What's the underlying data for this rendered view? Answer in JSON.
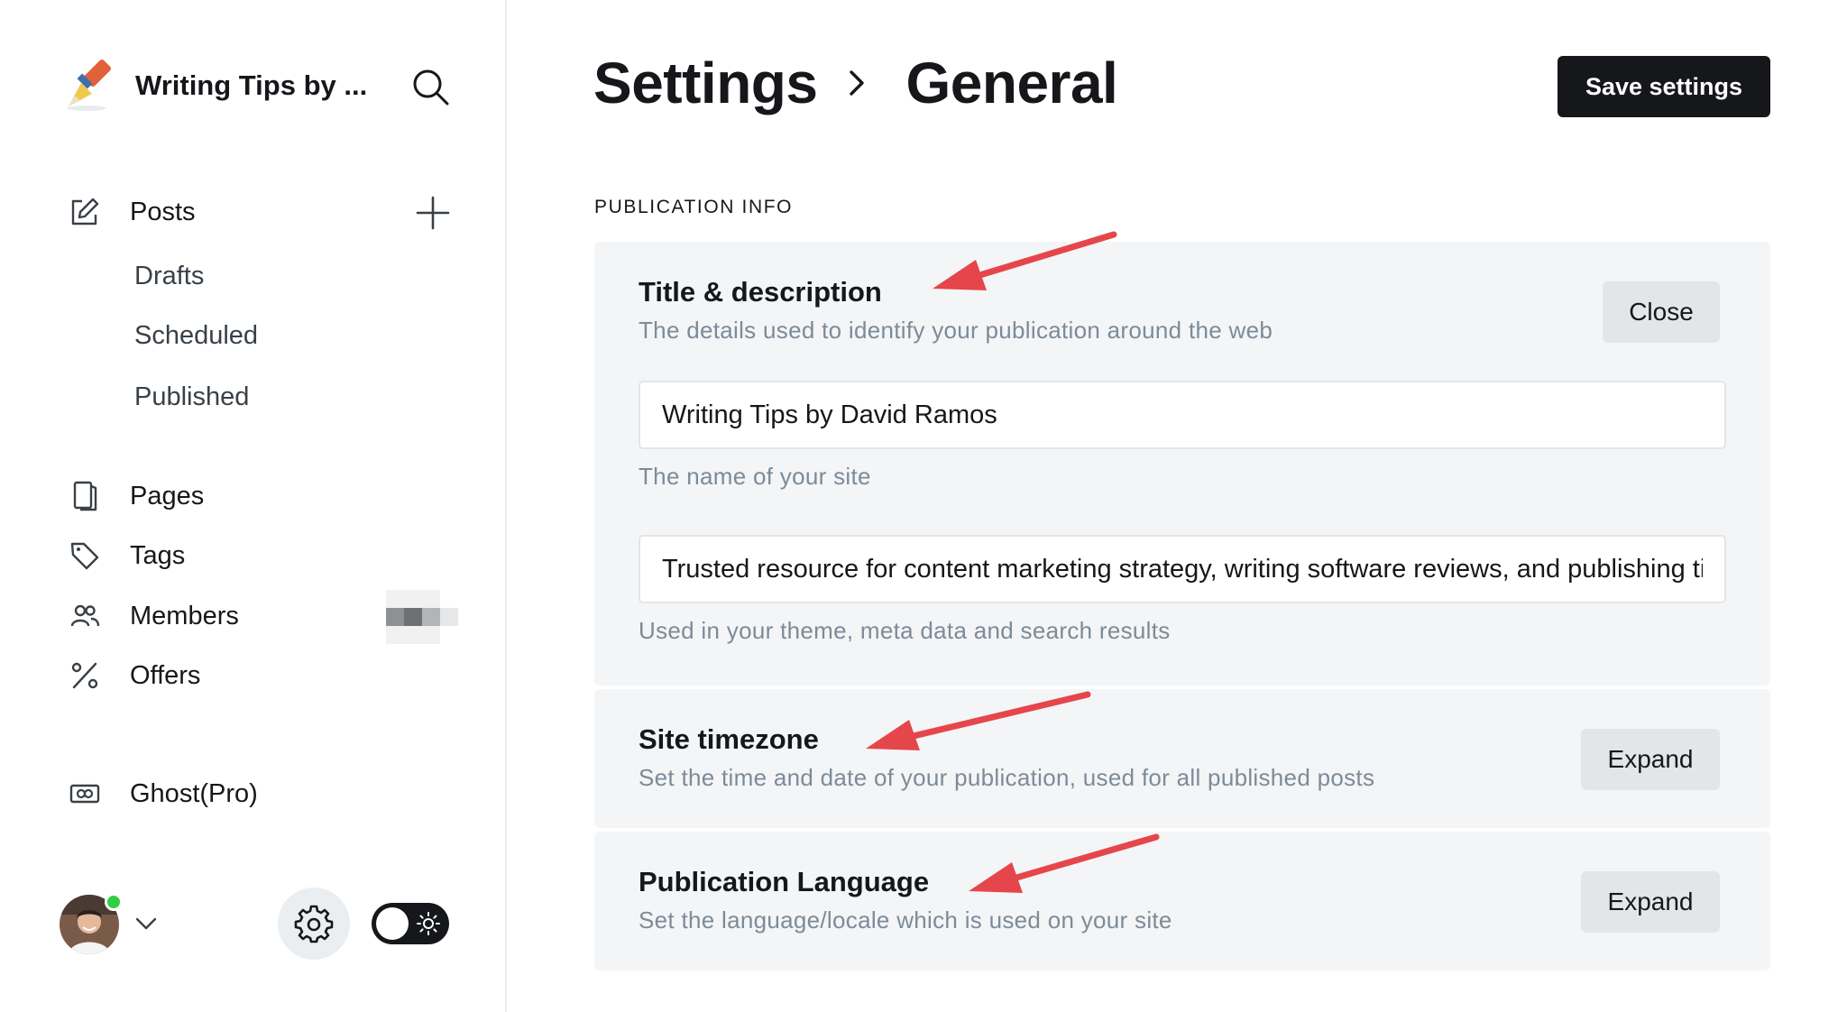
{
  "sidebar": {
    "brand_title": "Writing Tips by ...",
    "nav": {
      "posts": "Posts",
      "drafts": "Drafts",
      "scheduled": "Scheduled",
      "published": "Published",
      "pages": "Pages",
      "tags": "Tags",
      "members": "Members",
      "offers": "Offers",
      "ghost_pro": "Ghost(Pro)"
    }
  },
  "header": {
    "crumb_parent": "Settings",
    "crumb_current": "General",
    "save_label": "Save settings"
  },
  "section_label": "PUBLICATION INFO",
  "panels": {
    "title_desc": {
      "title": "Title & description",
      "description": "The details used to identify your publication around the web",
      "button": "Close",
      "site_name_value": "Writing Tips by David Ramos",
      "site_name_hint": "The name of your site",
      "site_desc_value": "Trusted resource for content marketing strategy, writing software reviews, and publishing tips",
      "site_desc_hint": "Used in your theme, meta data and search results"
    },
    "timezone": {
      "title": "Site timezone",
      "description": "Set the time and date of your publication, used for all published posts",
      "button": "Expand"
    },
    "language": {
      "title": "Publication Language",
      "description": "Set the language/locale which is used on your site",
      "button": "Expand"
    }
  },
  "colors": {
    "accent_dark": "#15171a",
    "panel_bg": "#f4f5f6",
    "muted_text": "#7c8b9a",
    "annotation_arrow": "#e5464c",
    "online_status": "#30cf43"
  }
}
